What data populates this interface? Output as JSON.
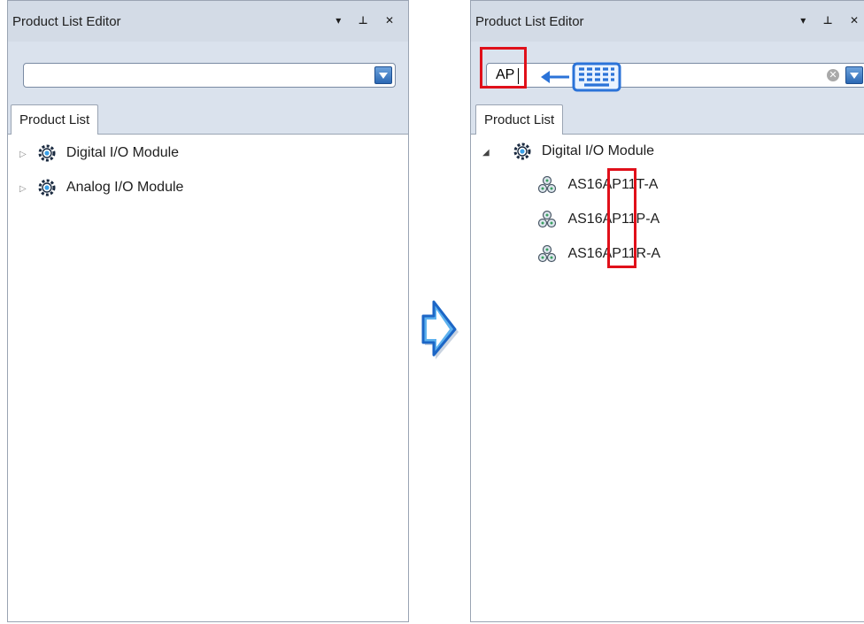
{
  "left_panel": {
    "title": "Product List Editor",
    "controls": "▾ ⊥ ✕",
    "search": {
      "value": ""
    },
    "tab": "Product List",
    "tree": [
      {
        "label": "Digital I/O Module",
        "expander": "▷"
      },
      {
        "label": "Analog I/O Module",
        "expander": "▷"
      }
    ]
  },
  "right_panel": {
    "title": "Product List Editor",
    "controls": "▾ ⊥ ✕",
    "search": {
      "value": "AP",
      "clear": "✕"
    },
    "tab": "Product List",
    "tree": {
      "parent": {
        "label": "Digital I/O Module",
        "expander": "◢"
      },
      "children": [
        {
          "label": "AS16AP11T-A"
        },
        {
          "label": "AS16AP11P-A"
        },
        {
          "label": "AS16AP11R-A"
        }
      ]
    }
  },
  "colors": {
    "title_bg": "#d3dbe6",
    "toolbar_bg": "#dae2ed",
    "highlight_red": "#e0101a",
    "accent_blue": "#2b73d8"
  },
  "icons": {
    "module": "gear-icon",
    "product": "module-product-icon",
    "transition": "arrow-right-icon",
    "input_source": "keyboard-icon"
  }
}
